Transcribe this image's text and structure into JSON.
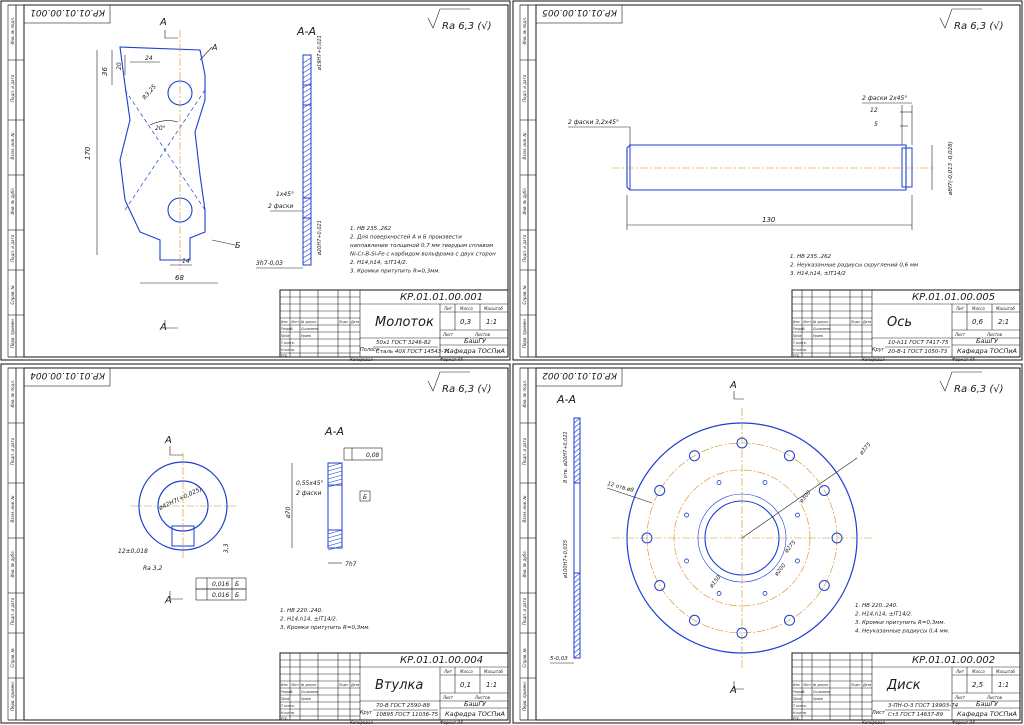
{
  "roughness": "Ra 6,3 (√)",
  "sheets": [
    {
      "code": "КР.01.01.00.001",
      "name": "Молоток",
      "mass": "0,3",
      "scale": "1:1",
      "material_1": "50х1 ГОСТ 3246-82",
      "material_2": "Сталь 40Х ГОСТ 14543-71",
      "material_prefix": "Полоса",
      "org_1": "БашГУ",
      "org_2": "Кафедра ТОСПиА",
      "notes": [
        "1. HB 235..262",
        "2. Для поверхностей А и Б произвести",
        "наплавление толщиной 0,7 мм твердым сплавом",
        "Ni-Cr-B-Si-Fe с карбидом вольфрама с двух сторон",
        "2. H14,h14, ±IT14/2.",
        "3. Кромки притупить R=0,3мм."
      ],
      "section": "А-А",
      "dims": [
        "170",
        "36",
        "20",
        "24",
        "R3,25",
        "20°",
        "68",
        "14",
        "1x45°",
        "2 фаски",
        "3h7-0,03",
        "ø19Н7+0,021",
        "ø20Н7+0,021"
      ],
      "labels": [
        "А",
        "А",
        "А",
        "Б"
      ]
    },
    {
      "code": "КР.01.01.00.005",
      "name": "Ось",
      "mass": "0,6",
      "scale": "2:1",
      "material_1": "10-h11 ГОСТ 7417-75",
      "material_2": "20-В-1 ГОСТ 1050-73",
      "material_prefix": "Круг",
      "org_1": "БашГУ",
      "org_2": "Кафедра ТОСПиА",
      "notes": [
        "1. HB 235..262",
        "2. Неуказанные радиусы скруглений 0,6 мм",
        "3. H14,h14, ±IT14/2"
      ],
      "dims": [
        "2 фаски 2x45°",
        "12",
        "5",
        "2 фаски 3,2x45°",
        "130",
        "ø8f7(-0,013 -0,028)"
      ]
    },
    {
      "code": "КР.01.01.00.004",
      "name": "Втулка",
      "mass": "0,1",
      "scale": "1:1",
      "material_1": "70-В ГОСТ 2590-88",
      "material_2": "10895 ГОСТ 11036-75",
      "material_prefix": "Круг",
      "org_1": "БашГУ",
      "org_2": "Кафедра ТОСПиА",
      "notes": [
        "1. HB 220..240.",
        "2. H14,h14, ±IT14/2.",
        "3. Кромки притупить R=0,3мм."
      ],
      "section": "А-А",
      "dims": [
        "ø42Н7(+0,025)",
        "12±0,018",
        "3,3",
        "Ra 3,2",
        "0,55x45°",
        "2 фаски",
        "ø70",
        "7h7",
        "0,08",
        "0,016",
        "0,016",
        "Б",
        "Б",
        "Б"
      ],
      "labels": [
        "А",
        "А"
      ]
    },
    {
      "code": "КР.01.01.00.002",
      "name": "Диск",
      "mass": "2,5",
      "scale": "1:1",
      "material_1": "3-ПН-О-3 ГОСТ 19903-74",
      "material_2": "Ст3 ГОСТ 14637-89",
      "material_prefix": "Лист",
      "org_1": "БашГУ",
      "org_2": "Кафедра ТОСПиА",
      "notes": [
        "1. HB 220..240.",
        "2. H14,h14, ±IT14/2.",
        "3. Кромки притупить R=0,3мм.",
        "4. Неуказанные радиусы 0,4 мм."
      ],
      "section": "А-А",
      "dims": [
        "ø375",
        "ø300",
        "ø275",
        "ø200",
        "ø150",
        "12 отв.ø8",
        "8 отв. ø20Н7+0,021",
        "ø100Н7+0,035",
        "5-0,03"
      ],
      "labels": [
        "А",
        "А"
      ]
    }
  ],
  "stamp_labels": {
    "lit": "Лит",
    "mass": "Масса",
    "scale": "Масштаб",
    "sheet": "Лист",
    "sheets": "Листов",
    "change": "Изм",
    "list": "Лист",
    "doc": "№ докум.",
    "sign": "Подп.",
    "date": "Дата",
    "dev": "Разраб.",
    "check": "Пров.",
    "tcontr": "Т.контр.",
    "ncontr": "Н.контр.",
    "appr": "Утв.",
    "dev_name": "Сычанина",
    "check_name": "Ураев",
    "copied": "Копировал",
    "format": "Формат А4"
  },
  "side_labels": [
    "Инв. № подл.",
    "Подп. и дата",
    "Взам. инв. №",
    "Инв. № дубл.",
    "Подп. и дата",
    "Справ. №",
    "Перв. примен."
  ]
}
